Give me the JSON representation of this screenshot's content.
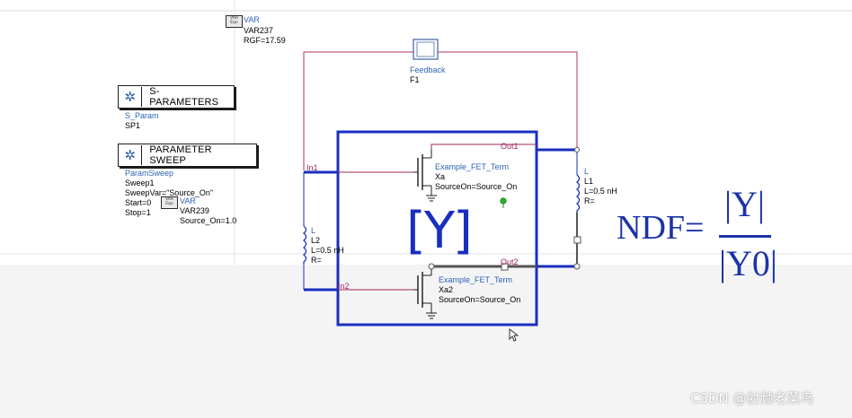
{
  "var_top": {
    "icon_label": "VAR Eqn",
    "type": "VAR",
    "name": "VAR237",
    "value": "RGF=17.59"
  },
  "sparams": {
    "title": "S-PARAMETERS",
    "type": "S_Param",
    "name": "SP1"
  },
  "psweep": {
    "title": "PARAMETER SWEEP",
    "type": "ParamSweep",
    "name": "Sweep1",
    "var": "SweepVar=\"Source_On\"",
    "start": "Start=0",
    "stop": "Stop=1"
  },
  "var_small": {
    "icon_label": "VAR Eqn",
    "type": "VAR",
    "name": "VAR239",
    "value": "Source_On=1.0"
  },
  "feedback": {
    "type": "Feedback",
    "name": "F1"
  },
  "ports": {
    "in1": "In1",
    "in2": "In2",
    "out1": "Out1",
    "out2": "Out2"
  },
  "fet1": {
    "type": "Example_FET_Term",
    "name": "Xa",
    "param": "SourceOn=Source_On"
  },
  "fet2": {
    "type": "Example_FET_Term",
    "name": "Xa2",
    "param": "SourceOn=Source_On"
  },
  "inductor1": {
    "type": "L",
    "name": "L1",
    "value": "L=0.5 nH",
    "r": "R="
  },
  "inductor2": {
    "type": "L",
    "name": "L2",
    "value": "L=0.5 nH",
    "r": "R="
  },
  "y_symbol": "[Y]",
  "ndf": {
    "label": "NDF=",
    "numerator": "|Y|",
    "denominator": "|Y0|"
  },
  "watermark": "CSDN @射频老菜鸟",
  "colors": {
    "wire": "#1a2ec0",
    "pin_wire": "#a0245c",
    "label_blue": "#2e63b8",
    "formula": "#1c33a6"
  }
}
